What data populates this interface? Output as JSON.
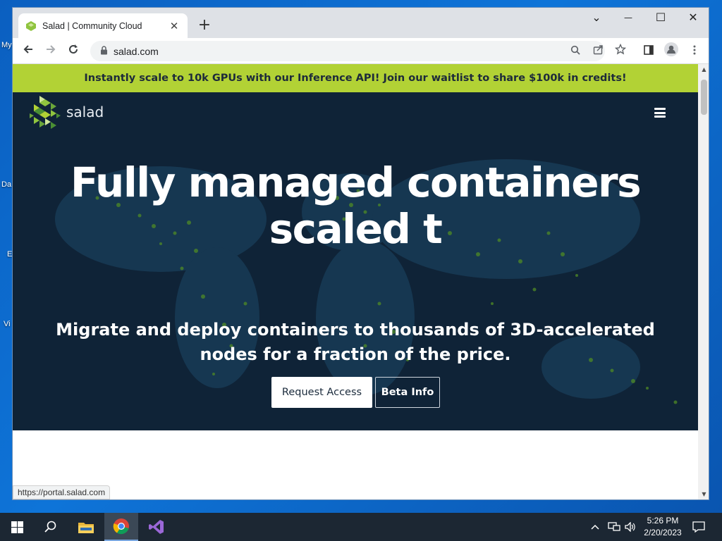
{
  "desktop": {
    "icon_labels": [
      "My",
      "Da",
      "E",
      "Vi"
    ]
  },
  "browser": {
    "tab": {
      "title": "Salad | Community Cloud"
    },
    "address": {
      "url": "salad.com"
    },
    "controls": {
      "tab_list": "⌄",
      "minimize": "—",
      "maximize": "☐",
      "close": "✕",
      "new_tab": "+",
      "tab_close": "✕"
    },
    "status_url": "https://portal.salad.com"
  },
  "site": {
    "banner_text": "Instantly scale to 10k GPUs with our Inference API! Join our waitlist to share $100k in credits!",
    "logo_text": "salad",
    "headline_line1": "Fully managed containers",
    "headline_line2": "scaled t",
    "subheadline": "Migrate and deploy containers to thousands of 3D-accelerated nodes for a fraction of the price.",
    "primary_button": "Request Access",
    "secondary_button": "Beta Info"
  },
  "taskbar": {
    "time": "5:26 PM",
    "date": "2/20/2023",
    "icons": [
      "windows-start-icon",
      "search-icon",
      "file-explorer-icon",
      "chrome-icon",
      "visual-studio-icon"
    ]
  },
  "colors": {
    "banner": "#b2d235",
    "hero_bg": "#0f2337",
    "map_dots": "#5c8d2a",
    "taskbar": "#1c2733"
  }
}
